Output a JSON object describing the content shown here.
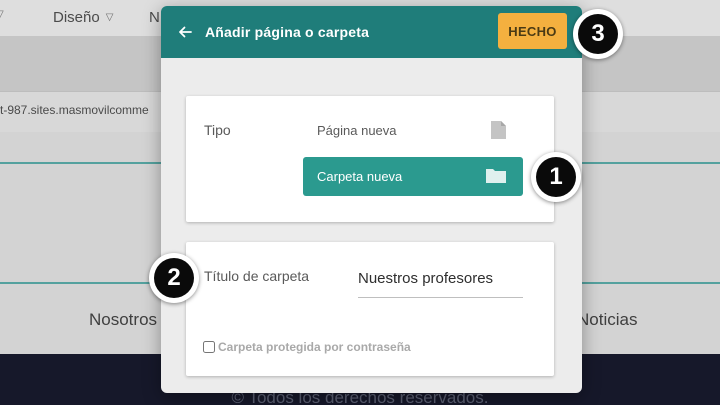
{
  "background": {
    "nav": [
      "Diseño",
      "N"
    ],
    "url_fragment": "t-987.sites.masmovilcomme",
    "links": [
      "Nosotros",
      "Noticias"
    ],
    "footer_text": "© Todos los derechos reservados."
  },
  "modal": {
    "title": "Añadir página o carpeta",
    "done_label": "HECHO",
    "type_label": "Tipo",
    "options": [
      {
        "label": "Página nueva",
        "icon": "file-icon",
        "selected": false
      },
      {
        "label": "Carpeta nueva",
        "icon": "folder-icon",
        "selected": true
      }
    ],
    "folder_title_label": "Título de carpeta",
    "folder_title_value": "Nuestros profesores",
    "password_label": "Carpeta protegida por contraseña",
    "password_checked": false
  },
  "steps": [
    "1",
    "2",
    "3"
  ],
  "colors": {
    "header": "#1f7d7a",
    "done_button": "#f4b03f",
    "selected_option": "#2b9a8f",
    "footer": "#16182a"
  }
}
